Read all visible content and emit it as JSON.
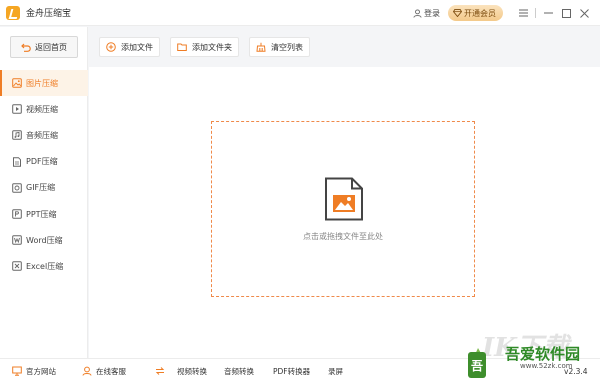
{
  "app": {
    "title": "金舟压缩宝",
    "logo_icon": "app-logo-icon"
  },
  "titlebar": {
    "login_label": "登录",
    "vip_label": "开通会员",
    "controls": [
      "menu-icon",
      "minimize-icon",
      "maximize-icon",
      "close-icon"
    ]
  },
  "sidebar": {
    "back_label": "返回首页",
    "items": [
      {
        "label": "图片压缩",
        "icon": "image-icon",
        "active": true
      },
      {
        "label": "视频压缩",
        "icon": "video-icon",
        "active": false
      },
      {
        "label": "音频压缩",
        "icon": "audio-icon",
        "active": false
      },
      {
        "label": "PDF压缩",
        "icon": "pdf-icon",
        "active": false
      },
      {
        "label": "GIF压缩",
        "icon": "gif-icon",
        "active": false
      },
      {
        "label": "PPT压缩",
        "icon": "ppt-icon",
        "active": false
      },
      {
        "label": "Word压缩",
        "icon": "word-icon",
        "active": false
      },
      {
        "label": "Excel压缩",
        "icon": "excel-icon",
        "active": false
      }
    ]
  },
  "toolbar": {
    "add_file": "添加文件",
    "add_folder": "添加文件夹",
    "clear_list": "清空列表"
  },
  "main": {
    "drop_hint": "点击或拖拽文件至此处"
  },
  "bottombar": {
    "website": "官方网站",
    "support": "在线客服",
    "video_convert": "视频转换",
    "audio_convert": "音频转换",
    "pdf_convert": "PDF转换器",
    "record": "录屏",
    "version": "v2.3.4"
  },
  "watermark": {
    "title": "吾爱软件园",
    "url": "www.52zk.com"
  },
  "colors": {
    "accent": "#ef7d25",
    "vip_bg": "#f3c98a",
    "sidebar_active_bg": "#fdf3e7"
  }
}
